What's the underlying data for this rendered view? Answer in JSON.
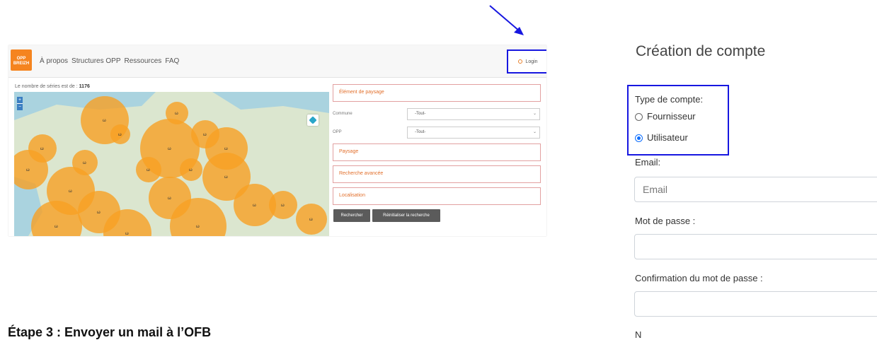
{
  "navbar": {
    "logo_lines": [
      "OPP",
      "BREIZH"
    ],
    "links": [
      "À propos",
      "Structures OPP",
      "Ressources",
      "FAQ"
    ],
    "login_label": "Login"
  },
  "map": {
    "count_label": "Le nombre de séries est de :",
    "count_value": "1176",
    "zoom_in": "+",
    "zoom_out": "−",
    "marker_label": "ω"
  },
  "filters": {
    "element_paysage": "Élément de paysage",
    "commune_label": "Commune",
    "commune_value": "-Tout-",
    "opp_label": "OPP",
    "opp_value": "-Tout-",
    "paysage": "Paysage",
    "recherche_avancee": "Recherche avancée",
    "localisation": "Localisation",
    "search_button": "Rechercher",
    "reset_button": "Réinitialiser la recherche"
  },
  "step_heading": "Étape 3 : Envoyer un mail à l’OFB",
  "account_form": {
    "title": "Création de compte",
    "type_label": "Type de compte:",
    "options": [
      {
        "label": "Fournisseur",
        "selected": false
      },
      {
        "label": "Utilisateur",
        "selected": true
      }
    ],
    "email_label": "Email:",
    "email_placeholder": "Email",
    "password_label": "Mot de passe :",
    "confirm_label": "Confirmation du mot de passe :",
    "next_label_partial": "N"
  },
  "colors": {
    "highlight": "#1717e0",
    "marker": "#f7a023",
    "accent": "#e26f2b"
  }
}
